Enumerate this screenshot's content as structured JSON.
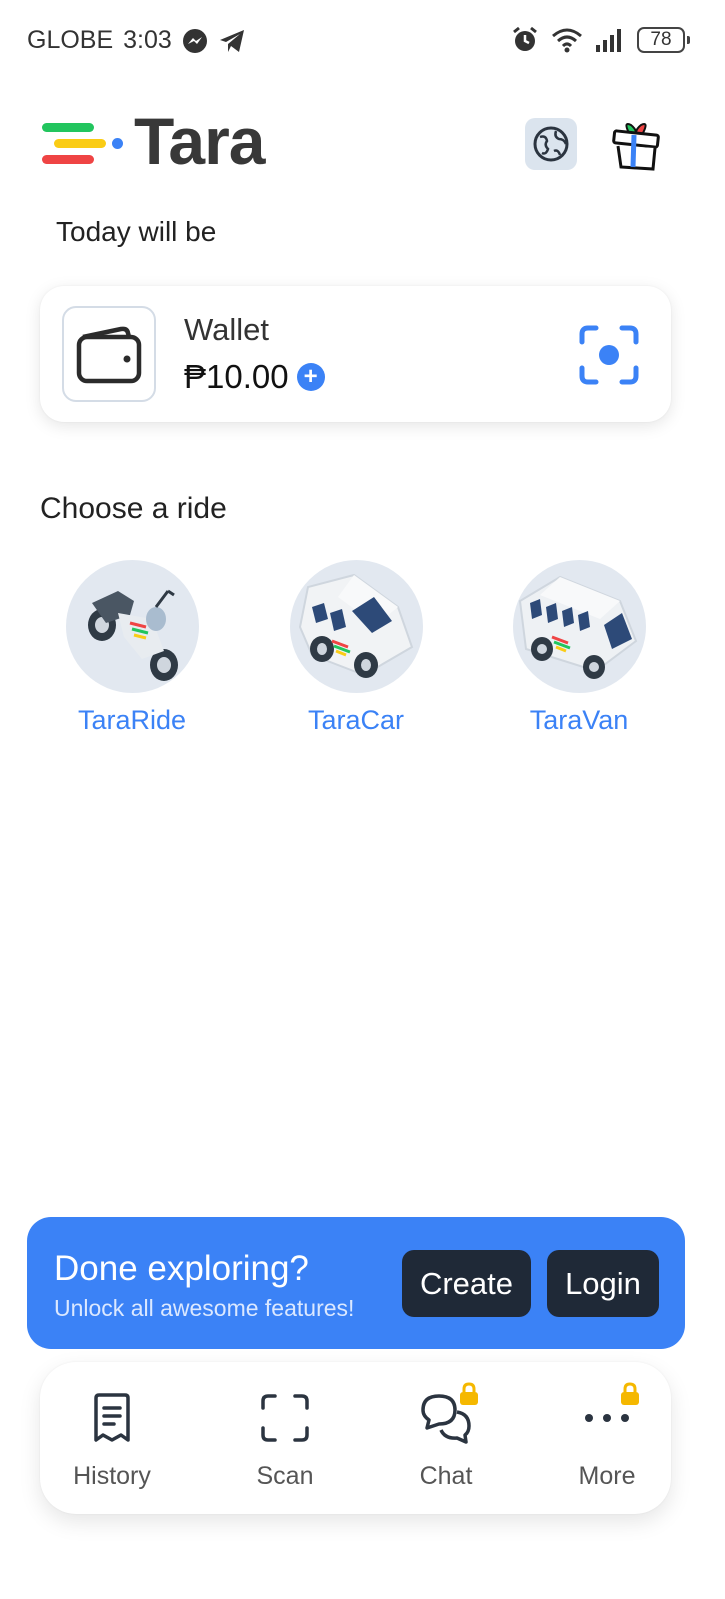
{
  "status_bar": {
    "carrier": "GLOBE",
    "time": "3:03",
    "battery": "78",
    "icons": [
      "messenger-icon",
      "telegram-icon",
      "alarm-icon",
      "wifi-icon",
      "signal-icon",
      "battery-icon"
    ]
  },
  "header": {
    "brand": "Tara",
    "logo_colors": [
      "#22c55e",
      "#facc15",
      "#ef4444",
      "#3b82f6"
    ],
    "globe_icon": "globe-icon",
    "gift_icon": "gift-icon"
  },
  "greeting": "Today will be",
  "wallet": {
    "title": "Wallet",
    "amount": "₱10.00",
    "add_icon": "+",
    "scan_icon": "scan-qr-icon"
  },
  "rides": {
    "title": "Choose a ride",
    "options": [
      {
        "label": "TaraRide",
        "icon": "motorcycle-icon"
      },
      {
        "label": "TaraCar",
        "icon": "car-icon"
      },
      {
        "label": "TaraVan",
        "icon": "van-icon"
      }
    ]
  },
  "cta": {
    "title": "Done exploring?",
    "subtitle": "Unlock all awesome features!",
    "create_label": "Create",
    "login_label": "Login"
  },
  "nav": {
    "items": [
      {
        "label": "History",
        "icon": "receipt-icon"
      },
      {
        "label": "Scan",
        "icon": "scan-frame-icon"
      },
      {
        "label": "Chat",
        "icon": "chat-icon",
        "locked": true
      },
      {
        "label": "More",
        "icon": "more-icon",
        "locked": true
      }
    ]
  },
  "colors": {
    "accent": "#3b82f6",
    "dark_button": "#1f2937",
    "lock": "#f5b800"
  }
}
